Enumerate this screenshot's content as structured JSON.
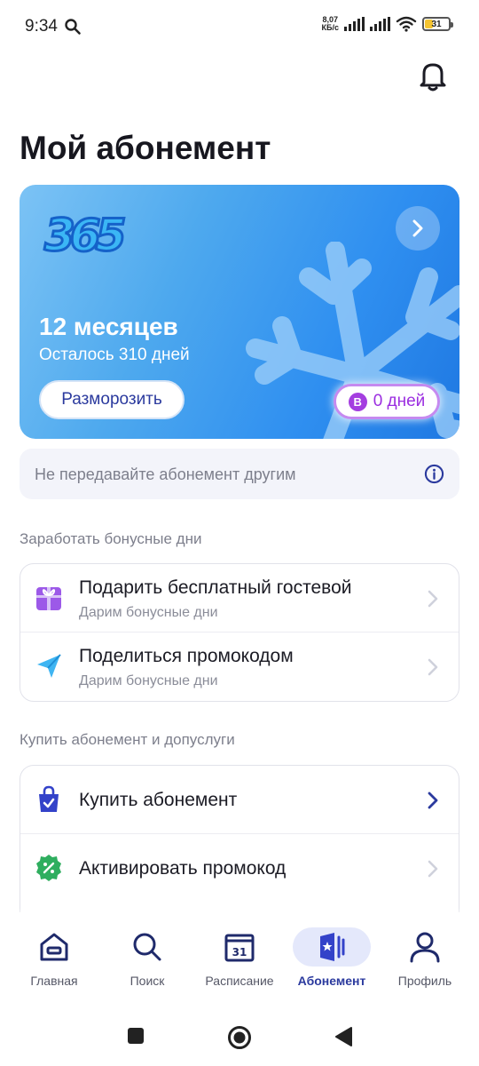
{
  "status_bar": {
    "time": "9:34",
    "net_speed_value": "8,07",
    "net_speed_unit": "КБ/с",
    "battery": "31"
  },
  "header": {
    "title": "Мой абонемент",
    "bell_icon": "bell-icon"
  },
  "subscription": {
    "period": "12 месяцев",
    "remaining": "Осталось 310 дней",
    "unfreeze_label": "Разморозить",
    "bonus_badge": "B",
    "bonus_days": "0 дней",
    "logo_icon": "logo-365-icon",
    "gradient_start": "#7cc3f5",
    "gradient_end": "#1f78e2"
  },
  "notice": {
    "text": "Не передавайте абонемент другим"
  },
  "bonus_section": {
    "title": "Заработать бонусные дни",
    "items": [
      {
        "title": "Подарить бесплатный гостевой",
        "subtitle": "Дарим бонусные дни",
        "icon": "gift-icon"
      },
      {
        "title": "Поделиться промокодом",
        "subtitle": "Дарим бонусные дни",
        "icon": "send-icon"
      }
    ]
  },
  "buy_section": {
    "title": "Купить абонемент и допуслуги",
    "items": [
      {
        "title": "Купить абонемент",
        "icon": "shopping-bag-icon"
      },
      {
        "title": "Активировать промокод",
        "icon": "promo-badge-icon"
      }
    ]
  },
  "bottom_nav": {
    "items": [
      {
        "label": "Главная",
        "icon": "home-icon"
      },
      {
        "label": "Поиск",
        "icon": "search-icon"
      },
      {
        "label": "Расписание",
        "icon": "calendar-icon",
        "calendar_day": "31"
      },
      {
        "label": "Абонемент",
        "icon": "membership-card-icon",
        "active": true
      },
      {
        "label": "Профиль",
        "icon": "user-icon"
      }
    ]
  },
  "colors": {
    "accent": "#2b3a9e",
    "bonus_purple": "#9b2ee0",
    "promo_green": "#2fae5f"
  }
}
